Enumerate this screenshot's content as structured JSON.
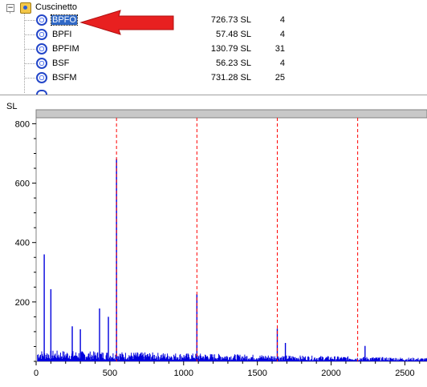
{
  "tree": {
    "root_label": "Cuscinetto",
    "expander": "−",
    "rows": [
      {
        "label": "BPFO",
        "value": "726.73 SL",
        "count": "4",
        "selected": true
      },
      {
        "label": "BPFI",
        "value": "57.48 SL",
        "count": "4",
        "selected": false
      },
      {
        "label": "BPFIM",
        "value": "130.79 SL",
        "count": "31",
        "selected": false
      },
      {
        "label": "BSF",
        "value": "56.23 SL",
        "count": "4",
        "selected": false
      },
      {
        "label": "BSFM",
        "value": "731.28 SL",
        "count": "25",
        "selected": false
      }
    ]
  },
  "annotation": {
    "arrow_color": "#e02020",
    "points_to": "BPFO"
  },
  "chart_data": {
    "type": "line",
    "ylabel": "SL",
    "xlim": [
      0,
      2650
    ],
    "ylim": [
      0,
      820
    ],
    "x_ticks": [
      0,
      500,
      1000,
      1500,
      2000,
      2500
    ],
    "y_ticks": [
      200,
      400,
      600,
      800
    ],
    "series_color": "#0000dd",
    "marker_color": "#ff0000",
    "markers_x": [
      545,
      1090,
      1635,
      2180
    ],
    "peaks": [
      {
        "x": 55,
        "y": 360
      },
      {
        "x": 100,
        "y": 243
      },
      {
        "x": 245,
        "y": 118
      },
      {
        "x": 300,
        "y": 108
      },
      {
        "x": 430,
        "y": 178
      },
      {
        "x": 490,
        "y": 150
      },
      {
        "x": 545,
        "y": 682
      },
      {
        "x": 1090,
        "y": 226
      },
      {
        "x": 1635,
        "y": 110
      },
      {
        "x": 1690,
        "y": 62
      },
      {
        "x": 2230,
        "y": 52
      }
    ],
    "noise_floor": 20
  },
  "colors": {
    "selection": "#3169c6",
    "plot_border": "#808080",
    "scroll_bar": "#c8c8c8"
  }
}
